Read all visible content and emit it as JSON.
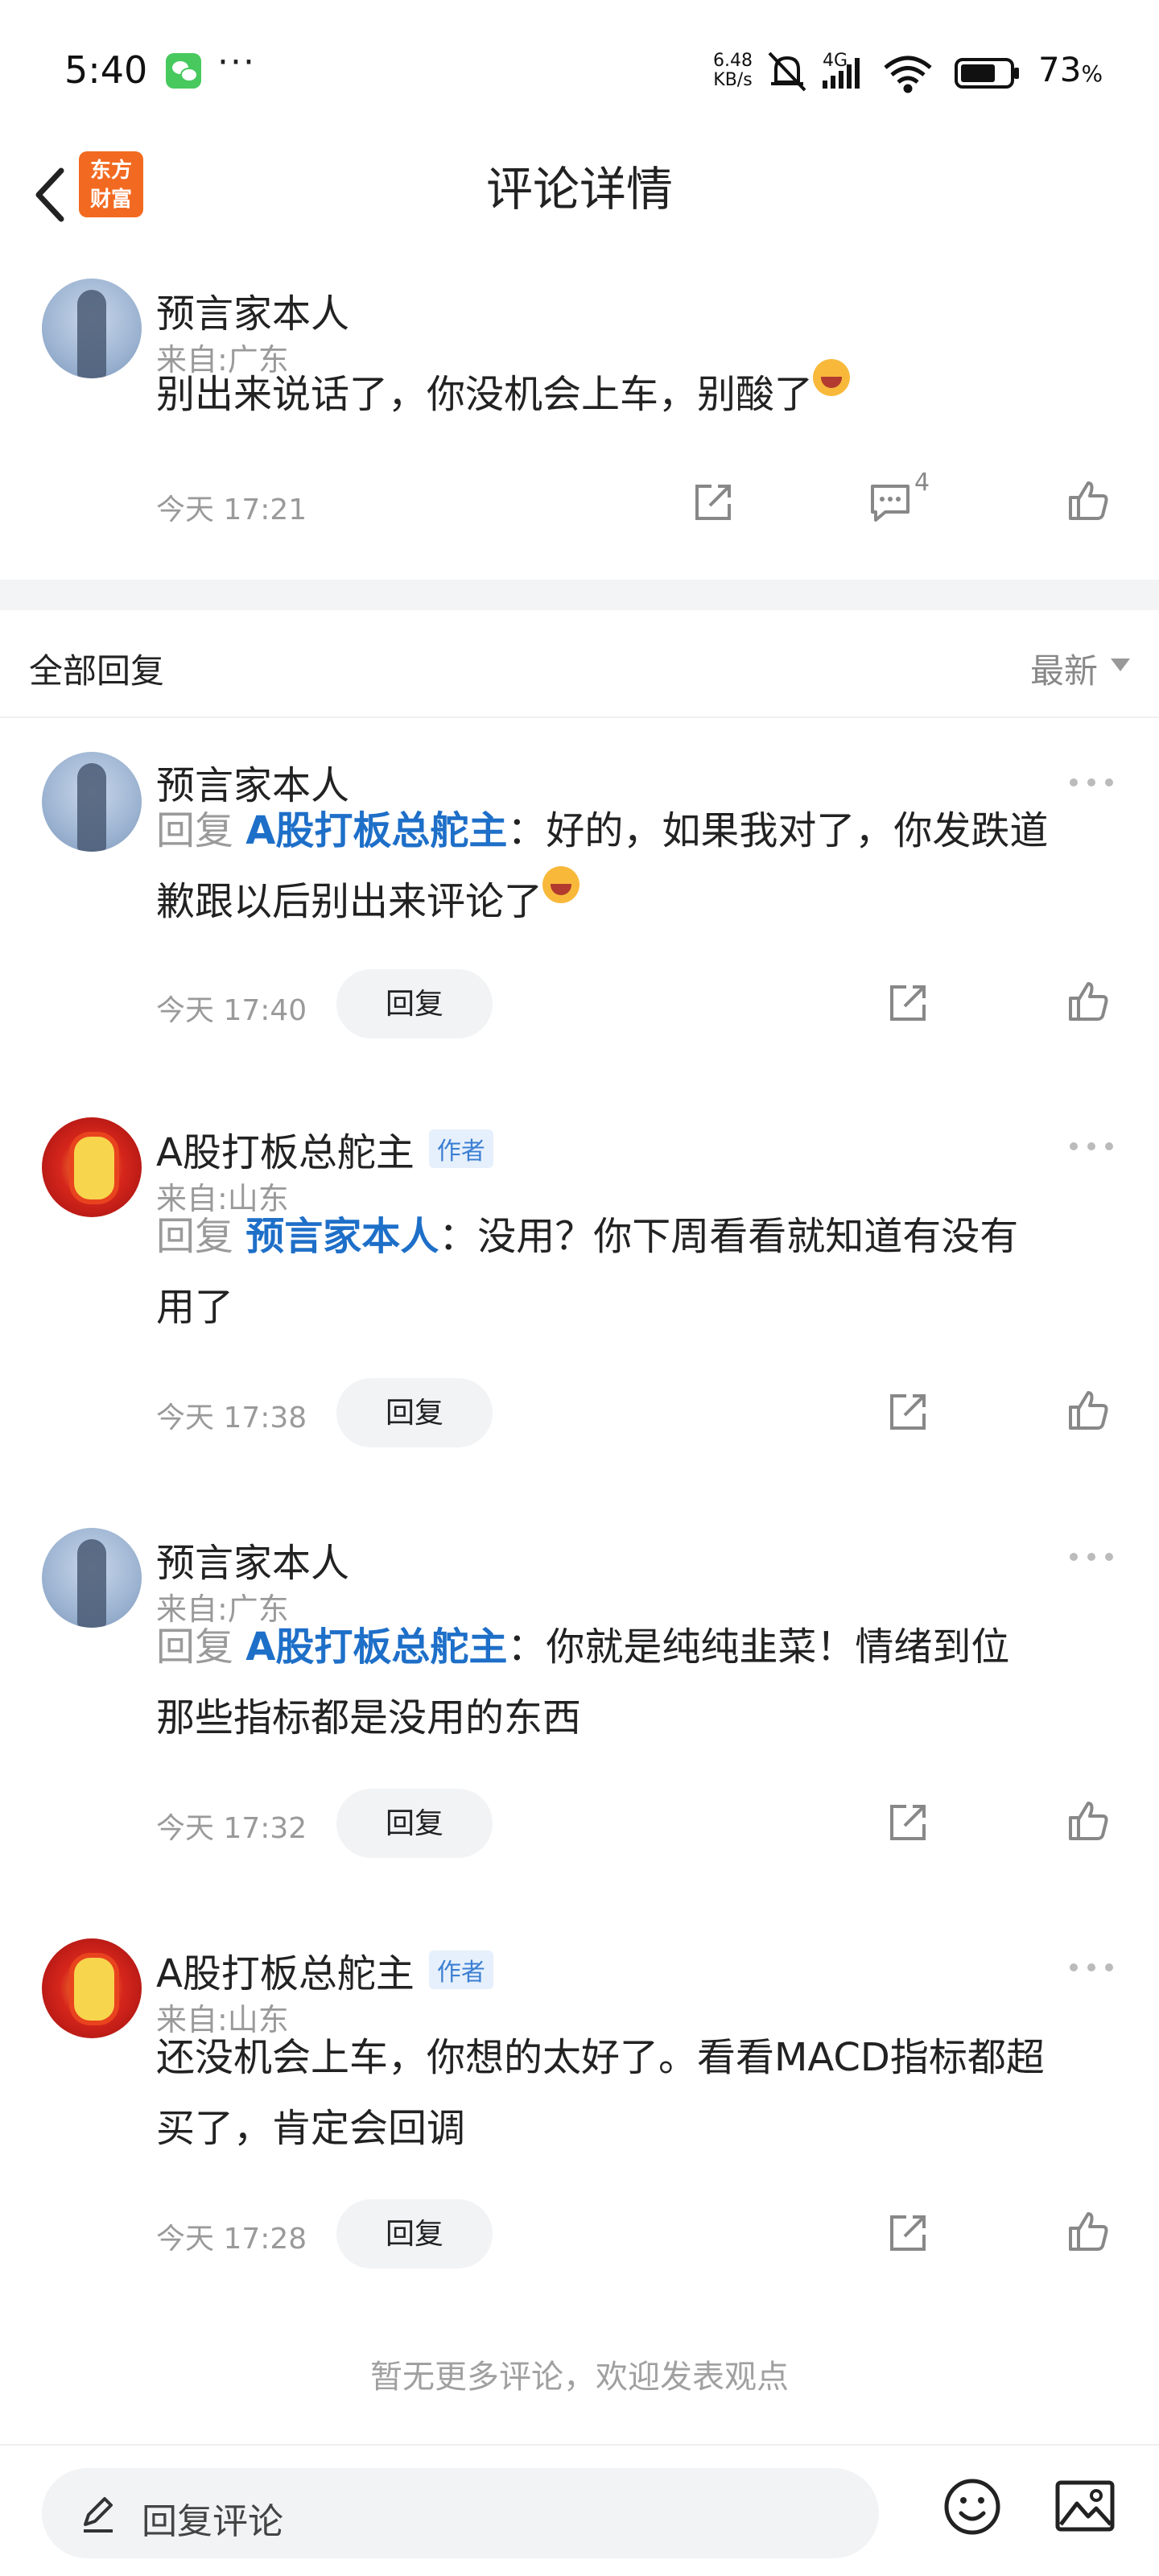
{
  "status_bar": {
    "time": "5:40",
    "net_speed_value": "6.48",
    "net_speed_unit": "KB/s",
    "network_type": "4G",
    "battery_percent": "73",
    "battery_unit": "%"
  },
  "header": {
    "logo_line1": "东方",
    "logo_line2": "财富",
    "title": "评论详情",
    "logo_color": "#f26a21"
  },
  "main_comment": {
    "username": "预言家本人",
    "location": "来自:广东",
    "text": "别出来说话了，你没机会上车，别酸了",
    "time": "今天 17:21",
    "reply_count": "4"
  },
  "replies_section": {
    "title": "全部回复",
    "sort_label": "最新"
  },
  "replies": [
    {
      "username": "预言家本人",
      "prefix": "回复 ",
      "target": "A股打板总舵主",
      "line1_rest": "：好的，如果我对了，你发跌道",
      "line2": "歉跟以后别出来评论了",
      "time": "今天 17:40",
      "reply_label": "回复"
    },
    {
      "username": "A股打板总舵主",
      "author_badge": "作者",
      "location": "来自:山东",
      "prefix": "回复 ",
      "target": "预言家本人",
      "line1_rest": "：没用？你下周看看就知道有没有",
      "line2": "用了",
      "time": "今天 17:38",
      "reply_label": "回复"
    },
    {
      "username": "预言家本人",
      "location": "来自:广东",
      "prefix": "回复 ",
      "target": "A股打板总舵主",
      "line1_rest": "：你就是纯纯韭菜！情绪到位",
      "line2": "那些指标都是没用的东西",
      "time": "今天 17:32",
      "reply_label": "回复"
    },
    {
      "username": "A股打板总舵主",
      "author_badge": "作者",
      "location": "来自:山东",
      "line1": "还没机会上车，你想的太好了。看看MACD指标都超",
      "line2": "买了，肯定会回调",
      "time": "今天 17:28",
      "reply_label": "回复"
    }
  ],
  "footer": {
    "no_more_text": "暂无更多评论，欢迎发表观点",
    "input_placeholder": "回复评论"
  },
  "colors": {
    "link_blue": "#1e6fc8",
    "muted_gray": "#9a9a9a",
    "pill_bg": "#f2f3f5"
  }
}
